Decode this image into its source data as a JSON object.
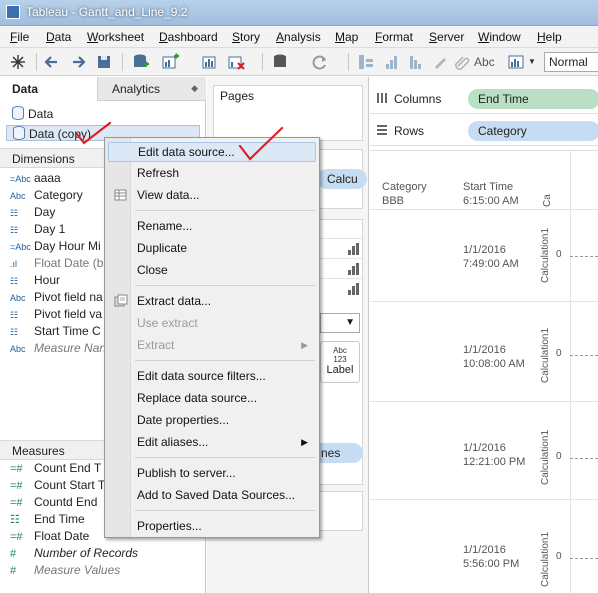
{
  "window": {
    "title": "Tableau - Gantt_and_Line_9.2"
  },
  "menu": [
    "File",
    "Data",
    "Worksheet",
    "Dashboard",
    "Story",
    "Analysis",
    "Map",
    "Format",
    "Server",
    "Window",
    "Help"
  ],
  "toolbar": {
    "abc_label": "Abc",
    "fit_value": "Normal"
  },
  "data_pane": {
    "tabs": {
      "data": "Data",
      "analytics": "Analytics"
    },
    "sources": [
      {
        "label": "Data"
      },
      {
        "label": "Data (copy)"
      }
    ],
    "dimensions_header": "Dimensions",
    "dimensions": [
      {
        "icon": "=Abc",
        "label": "aaaa"
      },
      {
        "icon": "Abc",
        "label": "Category"
      },
      {
        "icon": "☷",
        "label": "Day"
      },
      {
        "icon": "☷",
        "label": "Day 1"
      },
      {
        "icon": "=Abc",
        "label": "Day Hour Mi"
      },
      {
        "icon": ".ıl",
        "label": "Float Date (b"
      },
      {
        "icon": "☷",
        "label": "Hour"
      },
      {
        "icon": "Abc",
        "label": "Pivot field na"
      },
      {
        "icon": "☷",
        "label": "Pivot field va"
      },
      {
        "icon": "☷",
        "label": "Start Time C"
      },
      {
        "icon": "Abc",
        "label": "Measure Nan"
      }
    ],
    "measures_header": "Measures",
    "measures": [
      {
        "icon": "=#",
        "label": "Count End T"
      },
      {
        "icon": "=#",
        "label": "Count Start T"
      },
      {
        "icon": "=#",
        "label": "Countd End"
      },
      {
        "icon": "☷",
        "label": "End Time"
      },
      {
        "icon": "=#",
        "label": "Float Date"
      },
      {
        "icon": "#",
        "label": "Number of Records"
      },
      {
        "icon": "#",
        "label": "Measure Values"
      }
    ]
  },
  "shelves": {
    "pages": "Pages",
    "columns": "Columns",
    "columns_pill": "End Time",
    "rows": "Rows",
    "rows_pill": "Category",
    "calc_pill_fragment": "Calcu",
    "marks_label": "Label",
    "marks_label_icon": "Abc\n123",
    "measures_pill_fragment": "nes"
  },
  "view": {
    "headers": {
      "category": "Category",
      "start_time": "Start Time"
    },
    "category_value": "BBB",
    "first_time": "6:15:00 AM",
    "rows": [
      {
        "date": "1/1/2016",
        "time": "7:49:00 AM"
      },
      {
        "date": "1/1/2016",
        "time": "10:08:00 AM"
      },
      {
        "date": "1/1/2016",
        "time": "12:21:00 PM"
      },
      {
        "date": "1/1/2016",
        "time": "5:56:00 PM"
      }
    ],
    "axis_label": "Calculation1",
    "axis_zero": "0",
    "axis_fragment": "Ca"
  },
  "context_menu": {
    "items": [
      {
        "label": "Edit data source...",
        "state": "hover"
      },
      {
        "label": "Refresh"
      },
      {
        "label": "View data..."
      },
      {
        "label": "Rename..."
      },
      {
        "label": "Duplicate"
      },
      {
        "label": "Close"
      },
      {
        "label": "Extract data..."
      },
      {
        "label": "Use extract",
        "state": "disabled"
      },
      {
        "label": "Extract",
        "state": "disabled",
        "submenu": true
      },
      {
        "label": "Edit data source filters..."
      },
      {
        "label": "Replace data source..."
      },
      {
        "label": "Date properties..."
      },
      {
        "label": "Edit aliases...",
        "submenu": true
      },
      {
        "label": "Publish to server..."
      },
      {
        "label": "Add to Saved Data Sources..."
      },
      {
        "label": "Properties..."
      }
    ]
  },
  "colors": {
    "columns_pill": "#b9e0c4",
    "rows_pill": "#c6dcf2",
    "annotation": "#e02020",
    "menu_hover": "#dce8f6"
  }
}
